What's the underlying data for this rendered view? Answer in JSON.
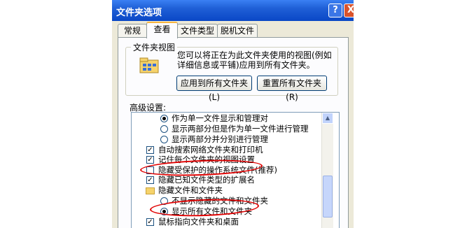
{
  "window": {
    "title": "文件夹选项",
    "help_btn": "?",
    "close_btn": "X"
  },
  "tabs": [
    {
      "label": "常规"
    },
    {
      "label": "查看"
    },
    {
      "label": "文件类型"
    },
    {
      "label": "脱机文件"
    }
  ],
  "folder_view": {
    "group_label": "文件夹视图",
    "description": "您可以将正在为此文件夹使用的视图(例如详细信息或平铺)应用到所有文件夹。",
    "apply_button": "应用到所有文件夹(L)",
    "reset_button": "重置所有文件夹(R)"
  },
  "advanced": {
    "label": "高级设置:",
    "items": [
      {
        "type": "radio",
        "checked": true,
        "text": "作为单一文件显示和管理对"
      },
      {
        "type": "radio",
        "checked": false,
        "text": "显示两部分但是作为单一文件进行管理"
      },
      {
        "type": "radio",
        "checked": false,
        "text": "显示两部分并分别进行管理"
      },
      {
        "type": "checkbox",
        "checked": true,
        "text": "自动搜索网络文件夹和打印机"
      },
      {
        "type": "checkbox",
        "checked": true,
        "text": "记住每个文件夹的视图设置"
      },
      {
        "type": "checkbox",
        "checked": false,
        "text": "隐藏受保护的操作系统文件(推荐)"
      },
      {
        "type": "checkbox",
        "checked": true,
        "text": "隐藏已知文件类型的扩展名"
      },
      {
        "type": "folder",
        "text": "隐藏文件和文件夹"
      },
      {
        "type": "radio",
        "checked": false,
        "text": "不显示隐藏的文件和文件夹"
      },
      {
        "type": "radio",
        "checked": true,
        "text": "显示所有文件和文件夹"
      },
      {
        "type": "checkbox",
        "checked": true,
        "text": "鼠标指向文件夹和桌面"
      }
    ]
  },
  "colors": {
    "title_bar": "#0a47c6",
    "highlight": "#e00000",
    "active_tab_accent": "#f7b53e"
  }
}
